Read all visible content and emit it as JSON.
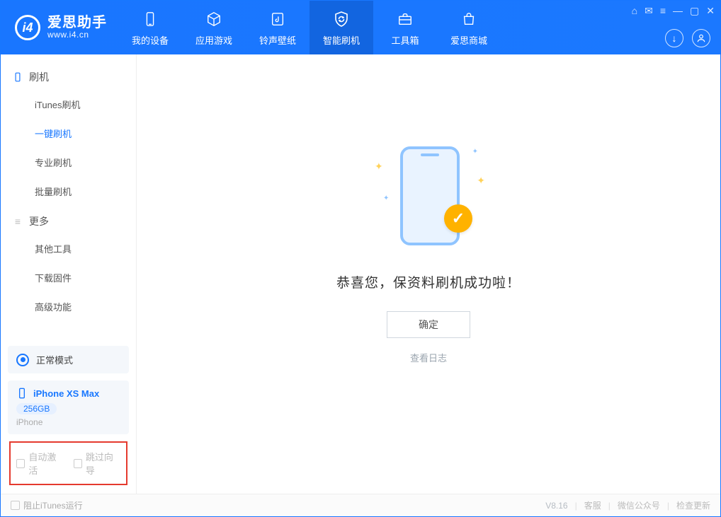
{
  "app": {
    "name": "爱思助手",
    "site": "www.i4.cn"
  },
  "tabs": [
    {
      "label": "我的设备"
    },
    {
      "label": "应用游戏"
    },
    {
      "label": "铃声壁纸"
    },
    {
      "label": "智能刷机"
    },
    {
      "label": "工具箱"
    },
    {
      "label": "爱思商城"
    }
  ],
  "sidebar": {
    "group1": {
      "title": "刷机",
      "items": [
        "iTunes刷机",
        "一键刷机",
        "专业刷机",
        "批量刷机"
      ]
    },
    "group2": {
      "title": "更多",
      "items": [
        "其他工具",
        "下载固件",
        "高级功能"
      ]
    }
  },
  "mode": {
    "label": "正常模式"
  },
  "device": {
    "name": "iPhone XS Max",
    "capacity": "256GB",
    "type": "iPhone"
  },
  "options": {
    "auto_activate": "自动激活",
    "skip_guide": "跳过向导"
  },
  "main": {
    "message": "恭喜您，保资料刷机成功啦！",
    "confirm": "确定",
    "view_log": "查看日志"
  },
  "footer": {
    "block_itunes": "阻止iTunes运行",
    "version": "V8.16",
    "links": [
      "客服",
      "微信公众号",
      "检查更新"
    ]
  }
}
